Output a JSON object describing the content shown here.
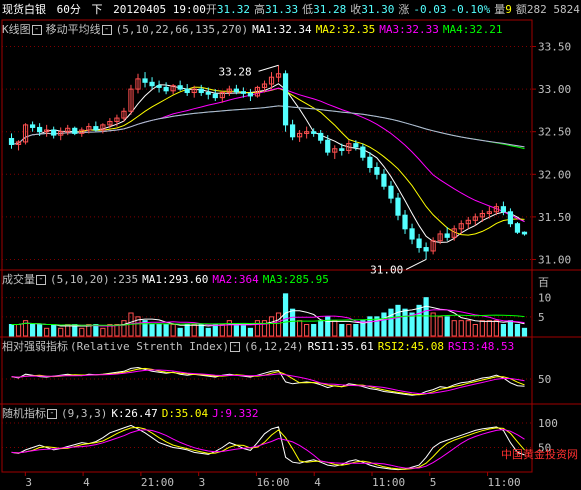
{
  "header": {
    "instrument": "现货白银",
    "period": "60分",
    "direction": "下",
    "datetime": "20120405 19:00",
    "open_label": "开",
    "open": "31.32",
    "high_label": "高",
    "high": "31.33",
    "low_label": "低",
    "low": "31.28",
    "close_label": "收",
    "close": "31.30",
    "change_label": "涨",
    "change": "-0.03",
    "change_pct": "-0.10%",
    "volume_label": "量",
    "volume": "9",
    "amount_label": "额",
    "amount": "282 5824"
  },
  "kline_panel": {
    "title": "K线图",
    "indicator_name": "移动平均线",
    "params": "(5,10,22,66,135,270)",
    "ma1": "MA1:32.34",
    "ma2": "MA2:32.35",
    "ma3": "MA3:32.33",
    "ma4": "MA4:32.21",
    "y_ticks": [
      "33.50",
      "33.00",
      "32.50",
      "32.00",
      "31.50",
      "31.00"
    ],
    "peak_label": "33.28",
    "trough_label": "31.00"
  },
  "volume_panel": {
    "title": "成交量",
    "params": "(5,10,20)",
    "value": ":235",
    "ma1": "MA1:293.60",
    "ma2": "MA2:364",
    "ma3": "MA3:285.95",
    "y_unit": "百",
    "y_ticks": [
      "10",
      "5"
    ]
  },
  "rsi_panel": {
    "title": "相对强弱指标",
    "indicator_name": "(Relative Strenth Index)",
    "params": "(6,12,24)",
    "rsi1": "RSI1:35.61",
    "rsi2": "RSI2:45.08",
    "rsi3": "RSI3:48.53",
    "y_ticks": [
      "50"
    ]
  },
  "kdj_panel": {
    "title": "随机指标",
    "params": "(9,3,3)",
    "k": "K:26.47",
    "d": "D:35.04",
    "j": "J:9.332",
    "y_ticks": [
      "100",
      "50"
    ]
  },
  "x_axis": {
    "ticks": [
      "3",
      "4",
      "21:00",
      "3",
      "16:00",
      "4",
      "11:00",
      "5",
      "11:00"
    ]
  },
  "watermark": "中国黄金投资网",
  "colors": {
    "up": "#ff5050",
    "down": "#54ffff",
    "ma1": "#ffffff",
    "ma2": "#ffff00",
    "ma3": "#ff00ff",
    "ma4": "#00ff00",
    "ma_blue": "#0000ff",
    "ma_gray": "#c0c0c0",
    "grid": "#800000",
    "frame": "#a00000"
  },
  "chart_data": {
    "type": "candlestick",
    "ohlc": [
      [
        32.42,
        32.48,
        32.3,
        32.35
      ],
      [
        32.35,
        32.4,
        32.28,
        32.38
      ],
      [
        32.38,
        32.6,
        32.35,
        32.58
      ],
      [
        32.58,
        32.62,
        32.5,
        32.55
      ],
      [
        32.55,
        32.6,
        32.45,
        32.5
      ],
      [
        32.5,
        32.58,
        32.44,
        32.52
      ],
      [
        32.52,
        32.56,
        32.42,
        32.46
      ],
      [
        32.46,
        32.55,
        32.4,
        32.5
      ],
      [
        32.5,
        32.58,
        32.46,
        32.54
      ],
      [
        32.54,
        32.56,
        32.46,
        32.48
      ],
      [
        32.48,
        32.55,
        32.44,
        32.52
      ],
      [
        32.52,
        32.6,
        32.48,
        32.56
      ],
      [
        32.56,
        32.62,
        32.5,
        32.52
      ],
      [
        32.52,
        32.6,
        32.48,
        32.58
      ],
      [
        32.58,
        32.66,
        32.54,
        32.62
      ],
      [
        32.62,
        32.7,
        32.56,
        32.66
      ],
      [
        32.66,
        32.78,
        32.62,
        32.74
      ],
      [
        32.74,
        33.05,
        32.7,
        33.0
      ],
      [
        33.0,
        33.18,
        32.95,
        33.12
      ],
      [
        33.12,
        33.2,
        33.02,
        33.08
      ],
      [
        33.08,
        33.14,
        33.0,
        33.04
      ],
      [
        33.04,
        33.1,
        32.96,
        33.02
      ],
      [
        33.02,
        33.08,
        32.94,
        32.98
      ],
      [
        32.98,
        33.06,
        32.94,
        33.04
      ],
      [
        33.04,
        33.1,
        32.98,
        33.0
      ],
      [
        33.0,
        33.06,
        32.92,
        32.96
      ],
      [
        32.96,
        33.04,
        32.9,
        33.0
      ],
      [
        33.0,
        33.05,
        32.92,
        32.96
      ],
      [
        32.96,
        33.02,
        32.88,
        32.94
      ],
      [
        32.94,
        33.0,
        32.86,
        32.9
      ],
      [
        32.9,
        32.98,
        32.84,
        32.96
      ],
      [
        32.96,
        33.04,
        32.92,
        33.0
      ],
      [
        33.0,
        33.05,
        32.94,
        32.97
      ],
      [
        32.97,
        33.02,
        32.9,
        32.95
      ],
      [
        32.95,
        33.0,
        32.86,
        32.92
      ],
      [
        32.92,
        33.04,
        32.9,
        33.02
      ],
      [
        33.02,
        33.1,
        32.96,
        33.06
      ],
      [
        33.06,
        33.2,
        33.0,
        33.14
      ],
      [
        33.14,
        33.28,
        33.08,
        33.18
      ],
      [
        33.18,
        33.22,
        32.5,
        32.58
      ],
      [
        32.58,
        32.64,
        32.4,
        32.44
      ],
      [
        32.44,
        32.52,
        32.38,
        32.48
      ],
      [
        32.48,
        32.56,
        32.42,
        32.5
      ],
      [
        32.5,
        32.54,
        32.44,
        32.48
      ],
      [
        32.48,
        32.52,
        32.36,
        32.4
      ],
      [
        32.4,
        32.46,
        32.22,
        32.26
      ],
      [
        32.26,
        32.34,
        32.18,
        32.3
      ],
      [
        32.3,
        32.36,
        32.22,
        32.28
      ],
      [
        32.28,
        32.4,
        32.24,
        32.36
      ],
      [
        32.36,
        32.4,
        32.28,
        32.32
      ],
      [
        32.32,
        32.36,
        32.16,
        32.2
      ],
      [
        32.2,
        32.26,
        32.02,
        32.08
      ],
      [
        32.08,
        32.14,
        31.94,
        32.0
      ],
      [
        32.0,
        32.06,
        31.82,
        31.86
      ],
      [
        31.86,
        31.92,
        31.66,
        31.72
      ],
      [
        31.72,
        31.78,
        31.46,
        31.52
      ],
      [
        31.52,
        31.58,
        31.3,
        31.36
      ],
      [
        31.36,
        31.42,
        31.18,
        31.24
      ],
      [
        31.24,
        31.3,
        31.08,
        31.14
      ],
      [
        31.14,
        31.2,
        31.0,
        31.1
      ],
      [
        31.1,
        31.26,
        31.06,
        31.22
      ],
      [
        31.22,
        31.34,
        31.18,
        31.3
      ],
      [
        31.3,
        31.38,
        31.22,
        31.26
      ],
      [
        31.26,
        31.4,
        31.22,
        31.36
      ],
      [
        31.36,
        31.46,
        31.3,
        31.42
      ],
      [
        31.42,
        31.5,
        31.36,
        31.46
      ],
      [
        31.46,
        31.54,
        31.4,
        31.5
      ],
      [
        31.5,
        31.58,
        31.44,
        31.54
      ],
      [
        31.54,
        31.62,
        31.48,
        31.56
      ],
      [
        31.56,
        31.66,
        31.52,
        31.62
      ],
      [
        31.62,
        31.68,
        31.52,
        31.56
      ],
      [
        31.56,
        31.6,
        31.38,
        31.42
      ],
      [
        31.42,
        31.44,
        31.3,
        31.32
      ],
      [
        31.32,
        31.33,
        31.28,
        31.3
      ]
    ],
    "volume": [
      3,
      3,
      4,
      3,
      3,
      2,
      3,
      2,
      3,
      3,
      2,
      3,
      3,
      2,
      3,
      3,
      4,
      6,
      5,
      4,
      3,
      3,
      3,
      3,
      2,
      3,
      3,
      3,
      2,
      3,
      3,
      4,
      3,
      3,
      2,
      4,
      4,
      5,
      6,
      11,
      7,
      4,
      3,
      3,
      4,
      5,
      4,
      3,
      3,
      3,
      4,
      5,
      5,
      6,
      7,
      8,
      7,
      6,
      8,
      10,
      6,
      5,
      5,
      4,
      4,
      4,
      3,
      4,
      4,
      4,
      3,
      4,
      3,
      2
    ],
    "rsi_levels": [
      55,
      52,
      60,
      58,
      55,
      54,
      56,
      58,
      60,
      58,
      57,
      60,
      59,
      60,
      62,
      64,
      66,
      72,
      74,
      70,
      66,
      64,
      62,
      64,
      60,
      58,
      60,
      58,
      56,
      54,
      58,
      60,
      58,
      56,
      54,
      58,
      62,
      66,
      68,
      44,
      40,
      42,
      44,
      42,
      38,
      32,
      36,
      34,
      40,
      38,
      34,
      30,
      28,
      24,
      22,
      20,
      18,
      16,
      18,
      24,
      28,
      34,
      32,
      38,
      42,
      44,
      48,
      52,
      54,
      58,
      52,
      42,
      36,
      35
    ],
    "kdj_levels": [
      40,
      38,
      45,
      50,
      55,
      50,
      45,
      48,
      52,
      56,
      60,
      58,
      62,
      70,
      80,
      85,
      90,
      95,
      88,
      80,
      70,
      60,
      55,
      50,
      48,
      45,
      40,
      38,
      36,
      42,
      50,
      60,
      55,
      48,
      44,
      60,
      78,
      88,
      92,
      30,
      20,
      18,
      22,
      25,
      20,
      14,
      12,
      15,
      22,
      25,
      20,
      14,
      10,
      8,
      6,
      5,
      6,
      10,
      14,
      30,
      50,
      60,
      65,
      70,
      75,
      80,
      85,
      88,
      90,
      92,
      85,
      60,
      40,
      35
    ]
  }
}
